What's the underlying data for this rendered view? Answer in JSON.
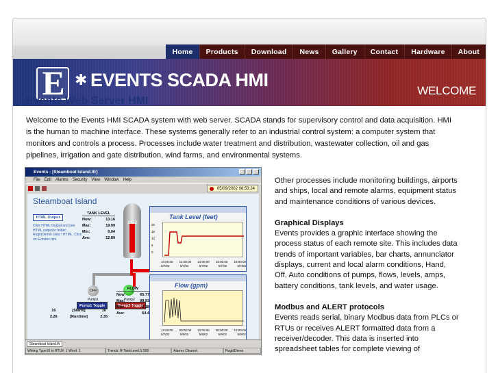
{
  "nav": {
    "items": [
      {
        "label": "Home",
        "active": true
      },
      {
        "label": "Products",
        "active": false
      },
      {
        "label": "Download",
        "active": false
      },
      {
        "label": "News",
        "active": false
      },
      {
        "label": "Gallery",
        "active": false
      },
      {
        "label": "Contact",
        "active": false
      },
      {
        "label": "Hardware",
        "active": false
      },
      {
        "label": "About",
        "active": false
      }
    ]
  },
  "banner": {
    "logo_letter": "E",
    "logo_symbol": "✱",
    "title": "EVENTS SCADA HMI",
    "section": "WELCOME"
  },
  "main": {
    "title": "Events Web Server HMI",
    "intro": "Welcome to the Events HMI SCADA system with web server.  SCADA stands for supervisory control and data acquisition.  HMI is the human to machine interface.  These systems generally refer to an industrial control system: a computer system that monitors and controls a process.  Processes include water treatment and distribution, wastewater collection, oil and gas pipelines, irrigation and gate distribution, wind farms, and environmental systems.",
    "side_intro": "Other processes include monitoring buildings, airports and ships, local and remote alarms, equipment status and maintenance conditions of various devices.",
    "graphical_heading": "Graphical Displays",
    "graphical_text": "Events provides a graphic interface showing the process status of each remote site.  This includes data trends of important variables, bar charts, annunciator displays, current and local alarm conditions, Hand, Off, Auto conditions of pumps, flows, levels, amps, battery conditions, tank levels, and water usage.",
    "modbus_heading": "Modbus and ALERT protocols",
    "modbus_text": "Events reads serial, binary Modbus data from PLCs or RTUs or receives ALERT formatted data from a receiver/decoder.  This data is inserted into spreadsheet tables for complete viewing of"
  },
  "screenshot": {
    "window_title": "Events - [Steamboat Island.lfr]",
    "menu": [
      "File",
      "Edit",
      "Alarms",
      "Security",
      "View",
      "Window",
      "Help"
    ],
    "timestamp": "05/09/2002 08:53:24",
    "site_title": "Steamboat Island",
    "html_button": "HTML Output",
    "note": "Click HTML Output and see HTML output in folder: RugidDemo\\ Data \\ HTML. Click on Evindex.htm",
    "tank_level": {
      "heading": "TANK LEVEL",
      "rows": [
        {
          "k": "Now:",
          "v": "13.16"
        },
        {
          "k": "Max:",
          "v": "19.99"
        },
        {
          "k": "Min:",
          "v": "0.04"
        },
        {
          "k": "Ave:",
          "v": "12.89"
        }
      ]
    },
    "tank_value": "13.16",
    "tank_fill_fraction": 0.66,
    "pump1": {
      "label": "Pump1",
      "state": "OFF",
      "toggle": "Pump1 Toggle"
    },
    "pump2": {
      "label": "Pump2",
      "toggle": "Pump2 Toggle"
    },
    "stats": {
      "rows": [
        [
          "16",
          "[Starts]",
          "16"
        ],
        [
          "2.26",
          "[Runtime]",
          "2.35"
        ]
      ]
    },
    "flow": {
      "heading": "FLOW",
      "rows": [
        {
          "k": "Now:",
          "v": "65.77"
        },
        {
          "k": "Max:",
          "v": "99.93"
        },
        {
          "k": "Min:",
          "v": "0.18"
        },
        {
          "k": "Ave:",
          "v": "64.4"
        }
      ]
    },
    "trend_level": {
      "title": "Tank Level (feet)",
      "y_ticks": [
        "20",
        "15",
        "10",
        "5",
        "0"
      ],
      "x_ticks": [
        "10:00:00",
        "12:00:00",
        "14:00:00",
        "16:00:00",
        "18:00:00"
      ],
      "x_dates": [
        "5/7/02",
        "5/7/02",
        "5/7/02",
        "5/7/02",
        "5/7/02"
      ]
    },
    "trend_flow": {
      "title": "Flow (gpm)",
      "x_ticks": [
        "12:00:00",
        "00:00:00",
        "12:00:00",
        "00:00:00",
        "12:00:00"
      ],
      "x_dates": [
        "5/7/02",
        "5/8/02",
        "5/8/02",
        "5/9/02",
        "5/9/02"
      ]
    },
    "status_tab": "Steamboat Island.lfr",
    "status_cells": [
      "Writing Type16 to RTU#: 1 Word: 1",
      "Trends: R-TankLevel.S 500",
      "Alarms Cleared.",
      "RugidDemo"
    ]
  },
  "colors": {
    "nav_active": "#1c2f6b",
    "nav_bg": "#4a1111",
    "title_blue": "#1f3479"
  }
}
